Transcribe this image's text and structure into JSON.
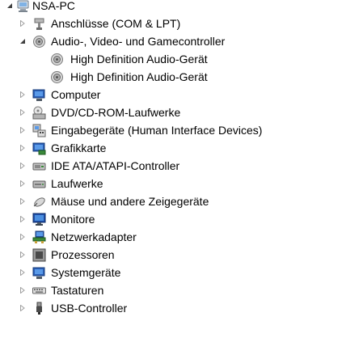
{
  "tree": {
    "root": {
      "label": "NSA-PC",
      "icon": "computer-root-icon",
      "expanded": true
    },
    "categories": [
      {
        "label": "Anschlüsse (COM & LPT)",
        "icon": "port-icon",
        "expanded": false
      },
      {
        "label": "Audio-, Video- und Gamecontroller",
        "icon": "speaker-icon",
        "expanded": true,
        "children": [
          {
            "label": "High Definition Audio-Gerät",
            "icon": "speaker-icon"
          },
          {
            "label": "High Definition Audio-Gerät",
            "icon": "speaker-icon"
          }
        ]
      },
      {
        "label": "Computer",
        "icon": "computer-icon",
        "expanded": false
      },
      {
        "label": "DVD/CD-ROM-Laufwerke",
        "icon": "dvd-drive-icon",
        "expanded": false
      },
      {
        "label": "Eingabegeräte (Human Interface Devices)",
        "icon": "hid-icon",
        "expanded": false
      },
      {
        "label": "Grafikkarte",
        "icon": "display-adapter-icon",
        "expanded": false
      },
      {
        "label": "IDE ATA/ATAPI-Controller",
        "icon": "ide-controller-icon",
        "expanded": false
      },
      {
        "label": "Laufwerke",
        "icon": "disk-drive-icon",
        "expanded": false
      },
      {
        "label": "Mäuse und andere Zeigegeräte",
        "icon": "mouse-icon",
        "expanded": false
      },
      {
        "label": "Monitore",
        "icon": "monitor-icon",
        "expanded": false
      },
      {
        "label": "Netzwerkadapter",
        "icon": "network-adapter-icon",
        "expanded": false
      },
      {
        "label": "Prozessoren",
        "icon": "processor-icon",
        "expanded": false
      },
      {
        "label": "Systemgeräte",
        "icon": "system-devices-icon",
        "expanded": false
      },
      {
        "label": "Tastaturen",
        "icon": "keyboard-icon",
        "expanded": false
      },
      {
        "label": "USB-Controller",
        "icon": "usb-icon",
        "expanded": false
      }
    ]
  },
  "colors": {
    "text": "#000000",
    "expander_collapsed": "#a0a0a0",
    "expander_expanded": "#404040",
    "icon_blue": "#2a5fb8",
    "icon_gray": "#8a8a8a"
  }
}
